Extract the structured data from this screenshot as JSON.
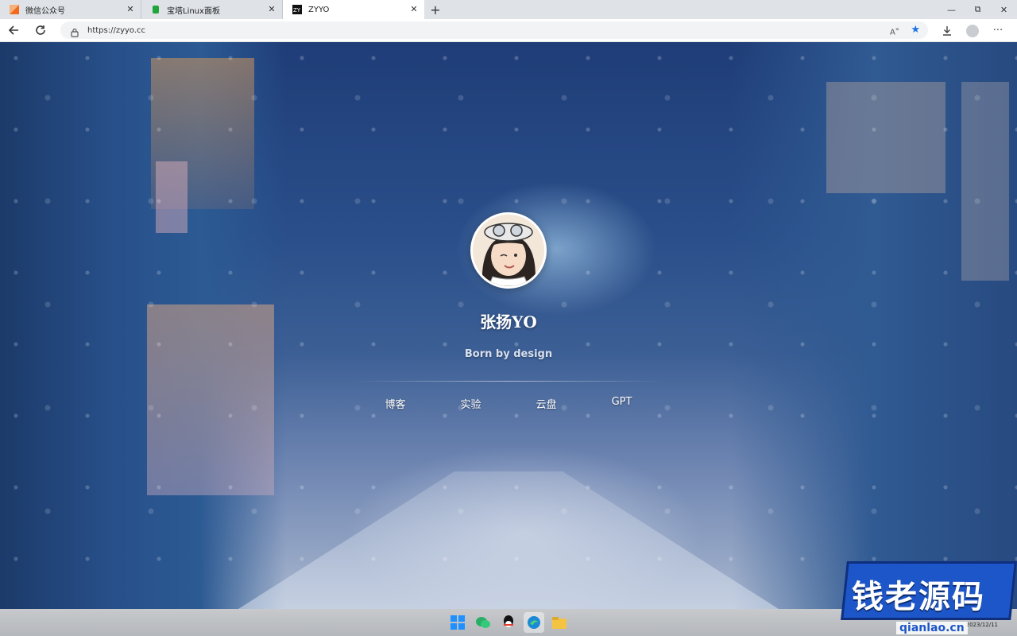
{
  "browser": {
    "tabs": [
      {
        "title": "微信公众号",
        "icon": "app-icon",
        "active": false
      },
      {
        "title": "宝塔Linux面板",
        "icon": "bt-panel-icon",
        "active": false
      },
      {
        "title": "ZYYO",
        "icon": "zyyo-icon",
        "active": true
      }
    ],
    "url": "https://zyyo.cc",
    "window_controls": {
      "minimize": "—",
      "restore": "⧉",
      "close": "✕"
    }
  },
  "profile": {
    "name": "张扬YO",
    "tagline": "Born by design",
    "links": [
      "博客",
      "实验",
      "云盘",
      "GPT"
    ]
  },
  "taskbar": {
    "apps": [
      "windows-start-icon",
      "wechat-icon",
      "qq-icon",
      "edge-icon",
      "file-explorer-icon"
    ],
    "date": "2023/12/11"
  },
  "watermark": {
    "text": "钱老源码",
    "domain": "qianlao.cn"
  },
  "colors": {
    "accent": "#1a73e8",
    "watermark_blue": "#1d56c8"
  }
}
